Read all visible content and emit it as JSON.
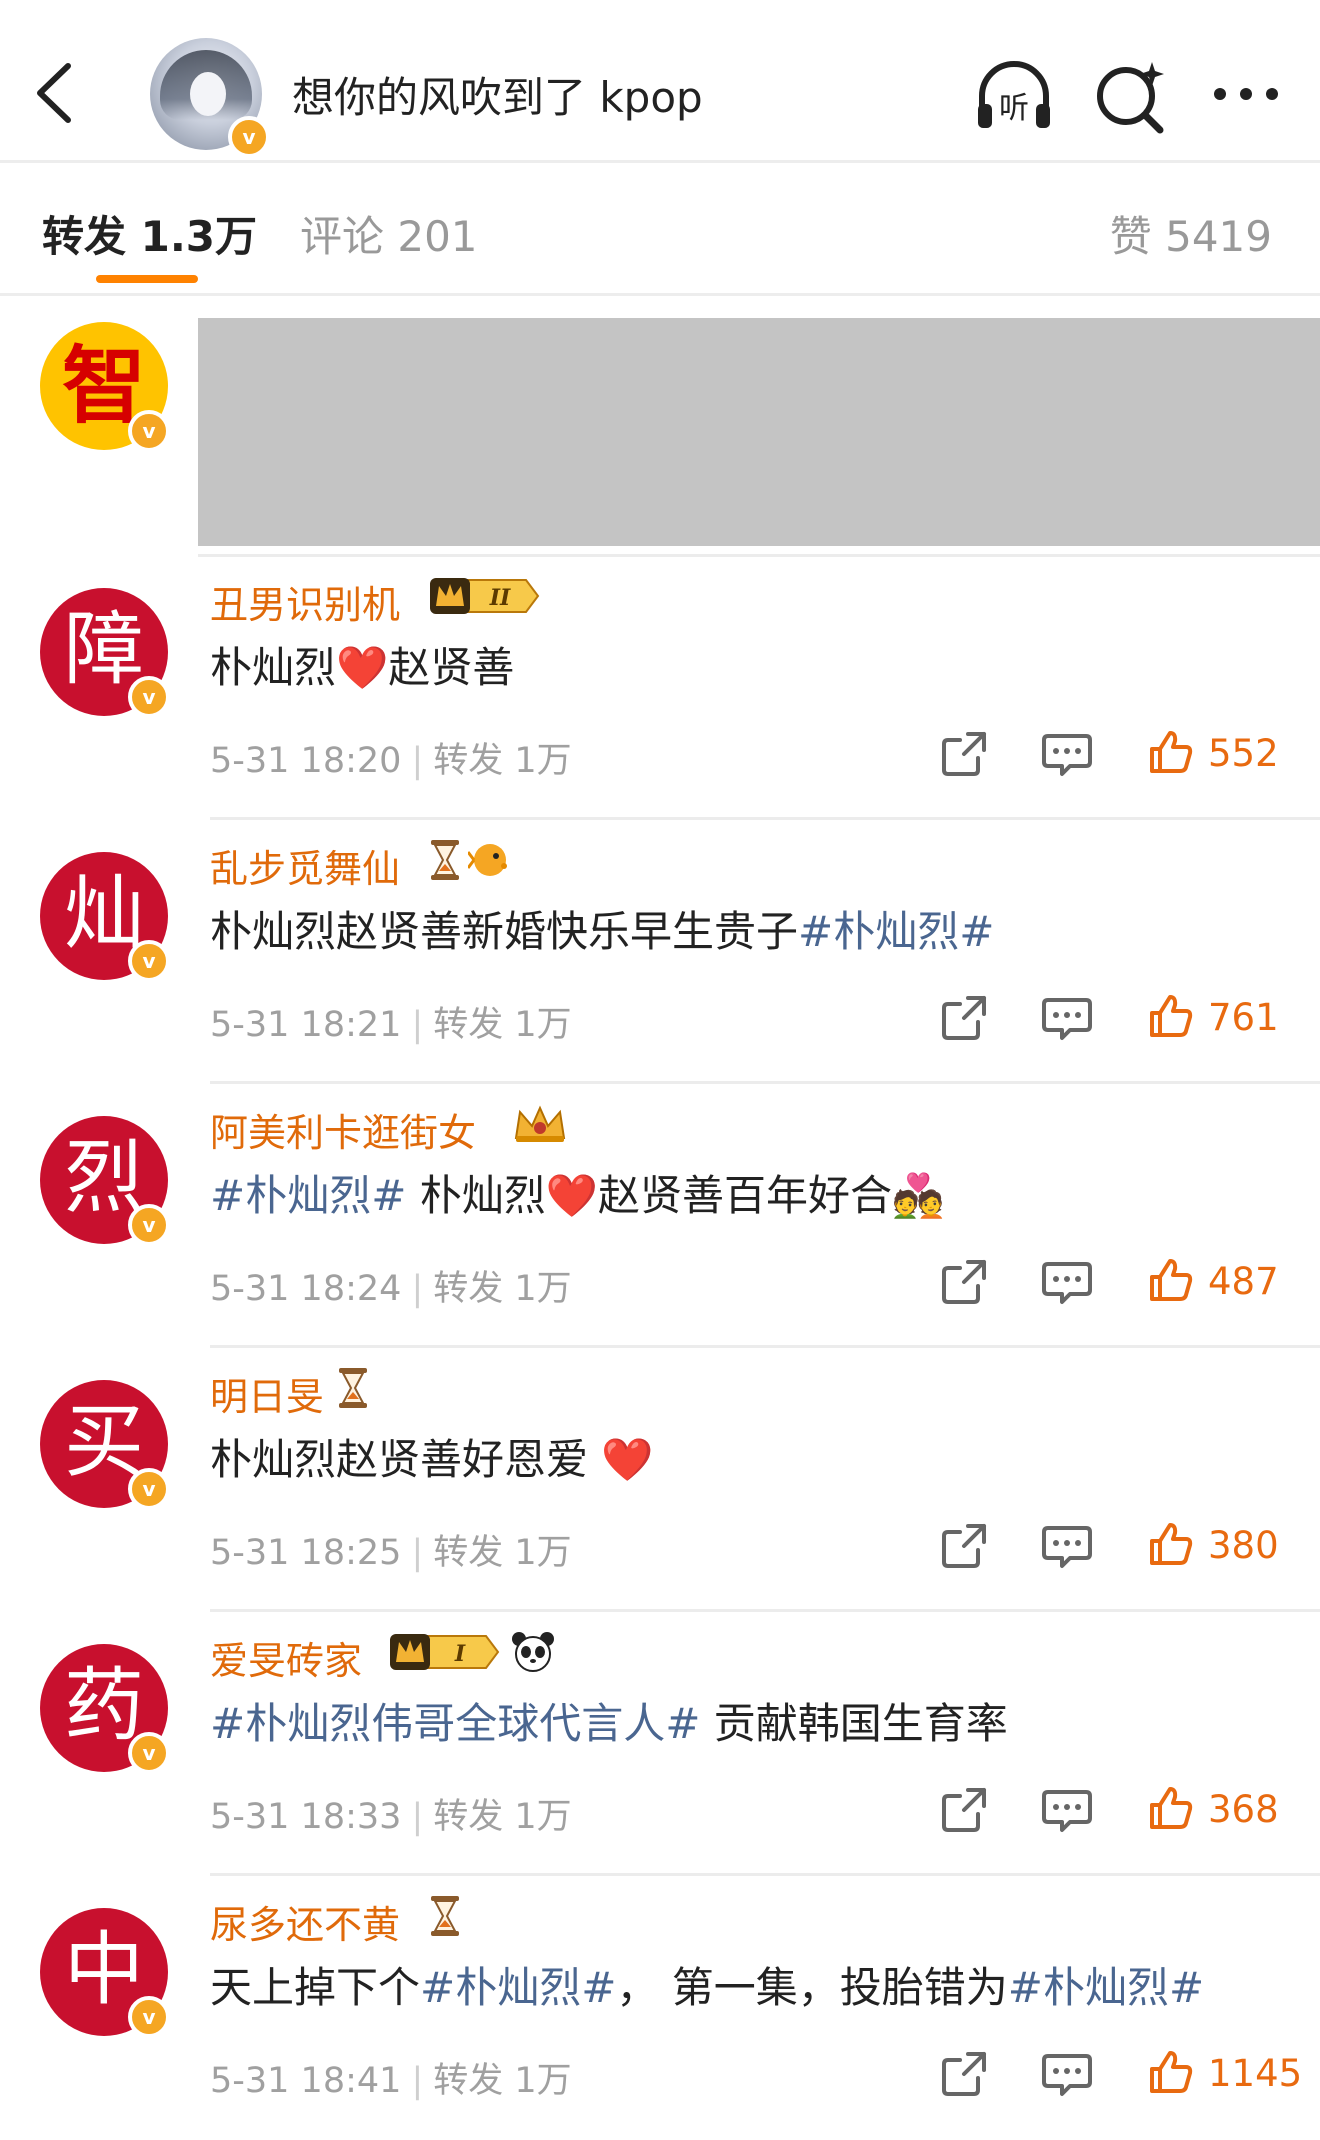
{
  "header": {
    "title": "想你的风吹到了 kpop",
    "back_icon": "chevron-left-icon",
    "listen_icon_label": "听",
    "icons": [
      "headphones-listen-icon",
      "search-sparkle-icon",
      "more-dots-icon"
    ]
  },
  "tabs": {
    "reposts": "转发 1.3万",
    "comments": "评论 201",
    "likes": "赞 5419",
    "accent": "#ff8200"
  },
  "redacted_avatar_char": "智",
  "comments": [
    {
      "avatar_char": "障",
      "username": "丑男识别机",
      "badges": [
        "crown-level-II-badge"
      ],
      "badge_text": "II",
      "segments": [
        {
          "text": "朴灿烈",
          "type": "text"
        },
        {
          "text": "❤️",
          "type": "emoji"
        },
        {
          "text": "赵贤善",
          "type": "text"
        }
      ],
      "time": "5-31 18:20",
      "repost": "转发 1万",
      "likes": "552"
    },
    {
      "avatar_char": "灿",
      "username": "乱步觅舞仙",
      "badges": [
        "hourglass-icon",
        "pufferfish-icon"
      ],
      "segments": [
        {
          "text": "朴灿烈赵贤善新婚快乐早生贵子",
          "type": "text"
        },
        {
          "text": "#朴灿烈#",
          "type": "hashtag"
        }
      ],
      "time": "5-31 18:21",
      "repost": "转发 1万",
      "likes": "761"
    },
    {
      "avatar_char": "烈",
      "username": "阿美利卡逛街女",
      "badges": [
        "gold-crown-icon"
      ],
      "segments": [
        {
          "text": "#朴灿烈#",
          "type": "hashtag"
        },
        {
          "text": " 朴灿烈",
          "type": "text"
        },
        {
          "text": "❤️",
          "type": "emoji"
        },
        {
          "text": "赵贤善百年好合",
          "type": "text"
        },
        {
          "text": "💑",
          "type": "emoji"
        }
      ],
      "time": "5-31 18:24",
      "repost": "转发 1万",
      "likes": "487"
    },
    {
      "avatar_char": "买",
      "username": "明日旻",
      "badges": [
        "hourglass-icon"
      ],
      "segments": [
        {
          "text": "朴灿烈赵贤善好恩爱 ",
          "type": "text"
        },
        {
          "text": "❤️",
          "type": "emoji"
        }
      ],
      "time": "5-31 18:25",
      "repost": "转发 1万",
      "likes": "380"
    },
    {
      "avatar_char": "药",
      "username": "爱旻砖家",
      "badges": [
        "crown-level-I-badge",
        "panda-icon"
      ],
      "badge_text": "I",
      "segments": [
        {
          "text": "#朴灿烈伟哥全球代言人#",
          "type": "hashtag"
        },
        {
          "text": " 贡献韩国生育率",
          "type": "text"
        }
      ],
      "time": "5-31 18:33",
      "repost": "转发 1万",
      "likes": "368"
    },
    {
      "avatar_char": "中",
      "username": "尿多还不黄",
      "badges": [
        "hourglass-icon"
      ],
      "segments": [
        {
          "text": "天上掉下个",
          "type": "text"
        },
        {
          "text": "#朴灿烈#",
          "type": "hashtag"
        },
        {
          "text": "， 第一集，投胎错为",
          "type": "text"
        },
        {
          "text": "#朴灿烈#",
          "type": "hashtag"
        }
      ],
      "time": "5-31 18:41",
      "repost": "转发 1万",
      "likes": "1145"
    }
  ],
  "colors": {
    "username": "#e06a0a",
    "hashtag": "#4a6690",
    "avatar_bg": "#c8102e",
    "like": "#e86a10"
  }
}
